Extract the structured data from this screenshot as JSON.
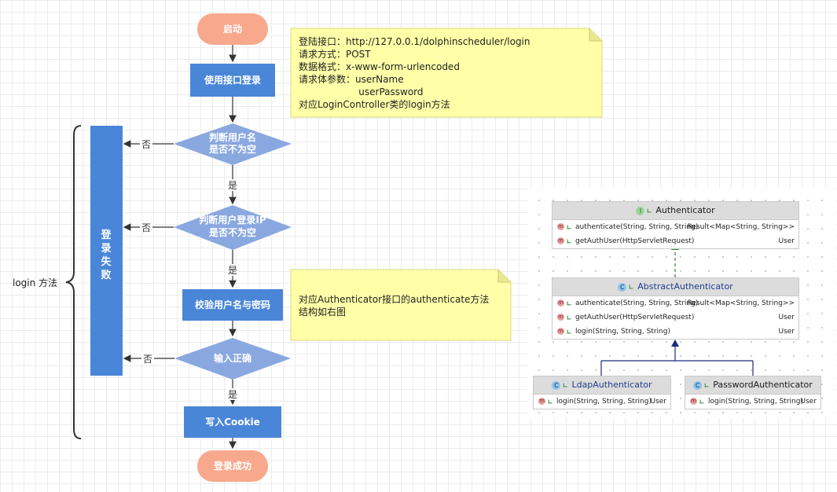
{
  "flow": {
    "start": "启动",
    "login_api": "使用接口登录",
    "check_username_1": "判断用户名",
    "check_username_2": "是否不为空",
    "check_ip_1": "判断用户登录IP",
    "check_ip_2": "是否不为空",
    "verify": "校验用户名与密码",
    "input_correct": "输入正确",
    "write_cookie": "写入Cookie",
    "success": "登录成功",
    "fail_chars": [
      "登",
      "录",
      "失",
      "败"
    ],
    "no": "否",
    "yes": "是",
    "brace_label": "login 方法"
  },
  "note1": {
    "lines": [
      "登陆接口：http://127.0.0.1/dolphinscheduler/login",
      "请求方式：POST",
      "数据格式：x-www-form-urlencoded",
      "请求体参数：userName",
      "                    userPassword",
      "对应LoginController类的login方法"
    ]
  },
  "note2": {
    "lines": [
      "对应Authenticator接口的authenticate方法",
      "结构如右图"
    ]
  },
  "uml": {
    "authenticator": {
      "name": "Authenticator",
      "badge": "I",
      "methods": [
        {
          "sig": "authenticate(String, String, String)",
          "ret": "Result<Map<String, String>>"
        },
        {
          "sig": "getAuthUser(HttpServletRequest)",
          "ret": "User"
        }
      ]
    },
    "abstract": {
      "name": "AbstractAuthenticator",
      "badge": "C",
      "methods": [
        {
          "sig": "authenticate(String, String, String)",
          "ret": "Result<Map<String, String>>"
        },
        {
          "sig": "getAuthUser(HttpServletRequest)",
          "ret": "User"
        },
        {
          "sig": "login(String, String, String)",
          "ret": "User"
        }
      ]
    },
    "ldap": {
      "name": "LdapAuthenticator",
      "badge": "C",
      "methods": [
        {
          "sig": "login(String, String, String)",
          "ret": "User"
        }
      ]
    },
    "password": {
      "name": "PasswordAuthenticator",
      "badge": "C",
      "methods": [
        {
          "sig": "login(String, String, String)",
          "ret": "User"
        }
      ]
    },
    "method_badge": "m"
  },
  "colors": {
    "start_fill": "#f8a88c",
    "process_fill": "#4a86d8",
    "decision_fill": "#8aa8e0",
    "note_fill": "#ffffa8",
    "note_border": "#d8d880"
  }
}
